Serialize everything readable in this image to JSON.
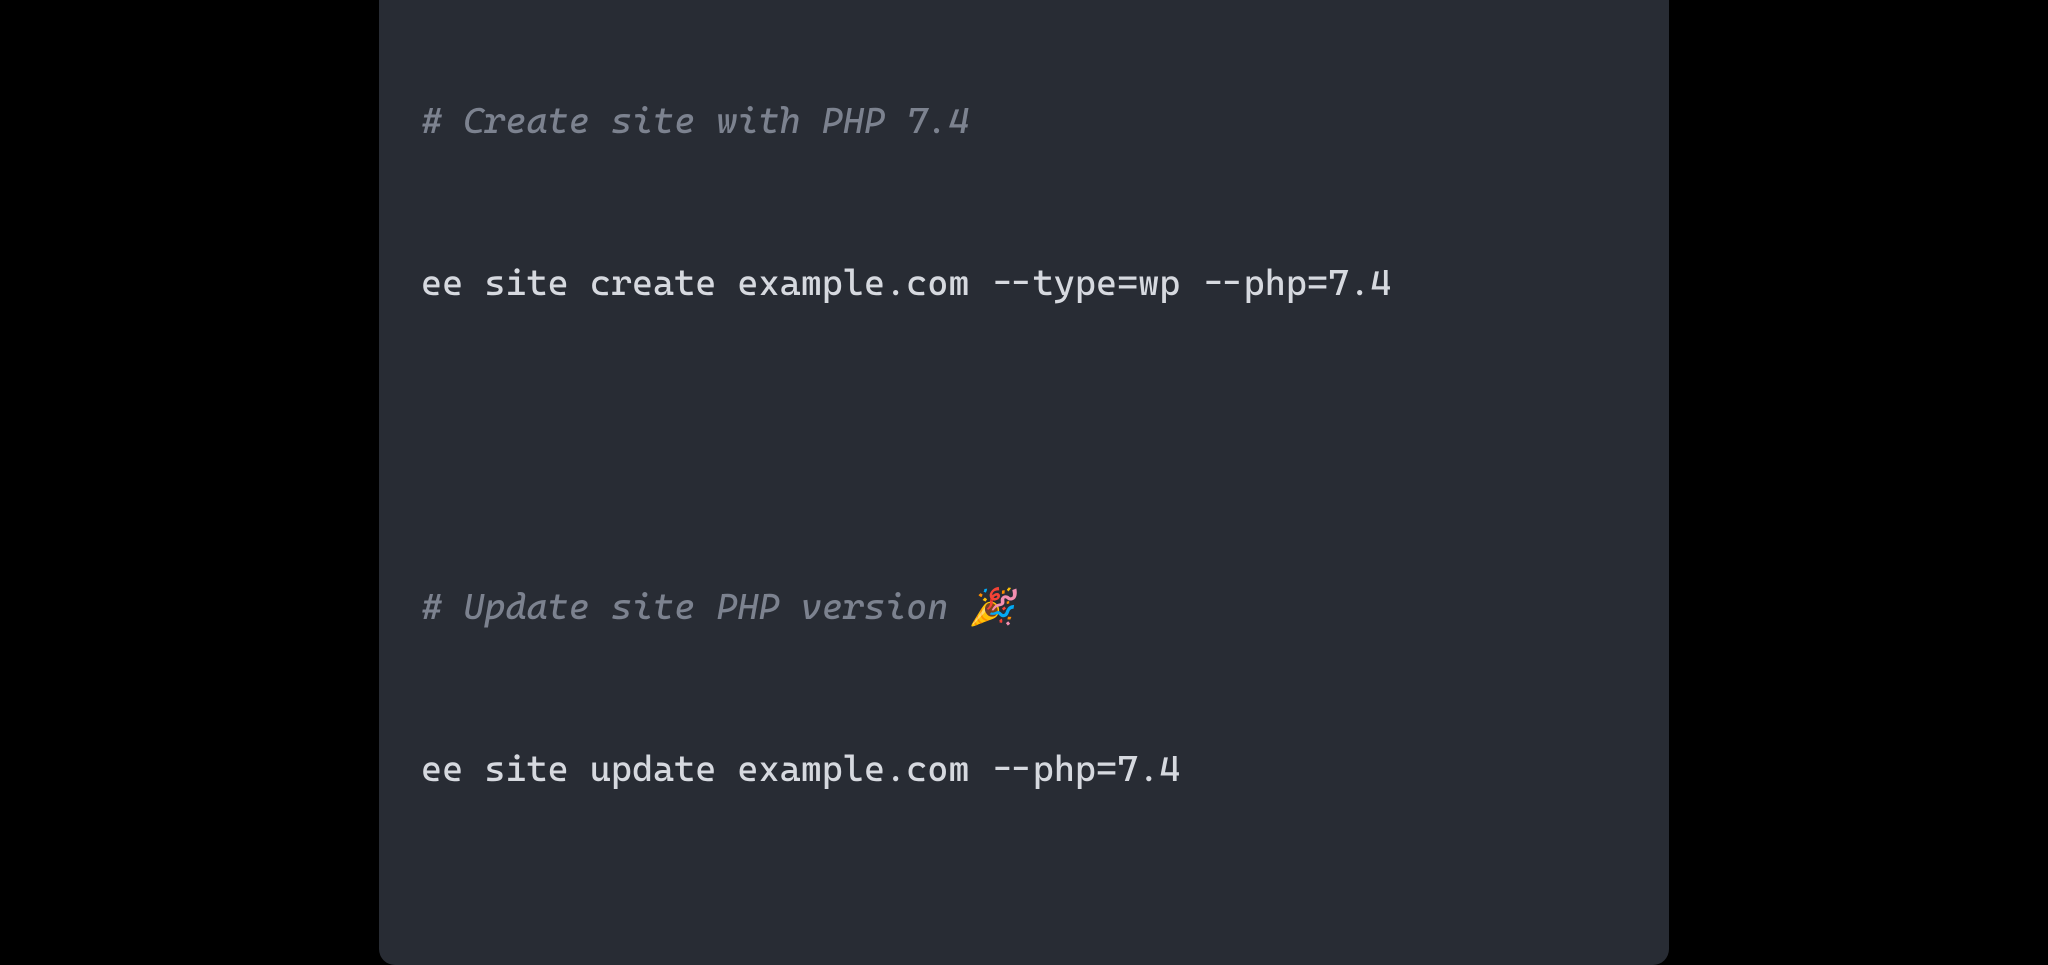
{
  "terminal": {
    "lines": [
      {
        "type": "comment",
        "text": "# Create site with PHP 7.4"
      },
      {
        "type": "command",
        "text": "ee site create example.com --type=wp --php=7.4"
      },
      {
        "type": "blank",
        "text": ""
      },
      {
        "type": "comment",
        "text": "# Update site PHP version 🎉"
      },
      {
        "type": "command",
        "text": "ee site update example.com --php=7.4"
      }
    ]
  },
  "colors": {
    "background": "#000000",
    "terminal_bg": "#282c34",
    "comment": "#7c828f",
    "command": "#d6d9df",
    "traffic_red": "#ff5f56",
    "traffic_yellow": "#ffbd2e",
    "traffic_green": "#27c93f"
  }
}
